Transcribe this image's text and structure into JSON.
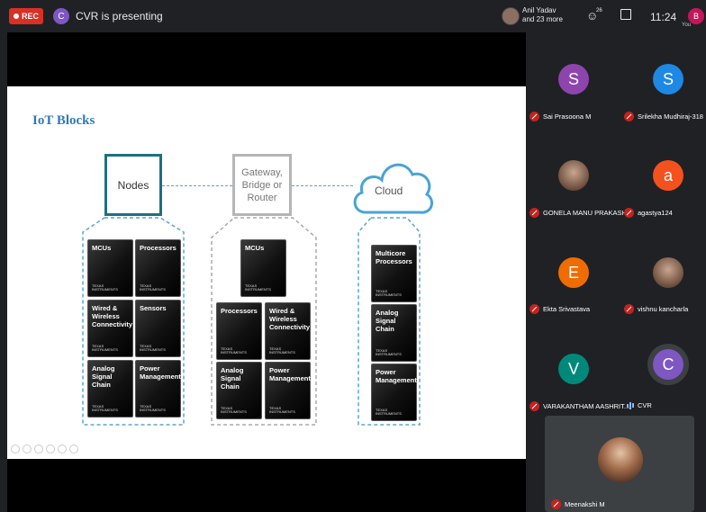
{
  "top_bar": {
    "rec_label": "REC",
    "presenter_initial": "C",
    "presenting_text": "CVR is presenting",
    "participants_stack_line1": "Anil Yadav",
    "participants_stack_line2": "and 23 more",
    "people_icon": "people-icon",
    "people_count": "26",
    "chat_icon": "chat-icon",
    "time": "11:24",
    "self_initial": "B",
    "self_label": "You"
  },
  "slide": {
    "title": "IoT Blocks",
    "nodes_label": "Nodes",
    "gateway_label": "Gateway,\nBridge or\nRouter",
    "cloud_label": "Cloud",
    "ti_line1": "TEXAS",
    "ti_line2": "INSTRUMENTS",
    "nodes_chips": [
      "MCUs",
      "Processors",
      "Wired & Wireless Connectivity",
      "Sensors",
      "Analog Signal Chain",
      "Power Management"
    ],
    "gateway_chips": [
      "MCUs",
      "Processors",
      "Wired & Wireless Connectivity",
      "Analog Signal Chain",
      "Power Management"
    ],
    "cloud_chips": [
      "Multicore Processors",
      "Analog Signal Chain",
      "Power Management"
    ]
  },
  "participants": [
    {
      "initial": "S",
      "name": "Sai Prasoona M",
      "color": "#8e44ad"
    },
    {
      "initial": "S",
      "name": "Srilekha Mudhiraj-318",
      "color": "#1e88e5"
    },
    {
      "initial": "",
      "name": "GONELA MANU PRAKASH",
      "color": "#9e9e9e"
    },
    {
      "initial": "a",
      "name": "agastya124",
      "color": "#f4511e"
    },
    {
      "initial": "E",
      "name": "Ekta Srivastava",
      "color": "#ef6c00"
    },
    {
      "initial": "",
      "name": "vishnu kancharla",
      "color": "#795548"
    },
    {
      "initial": "V",
      "name": "VARAKANTHAM AASHRIT...",
      "color": "#00897b"
    },
    {
      "initial": "C",
      "name": "CVR",
      "color": "#7e57c2"
    }
  ],
  "featured": {
    "name": "Meenakshi M"
  }
}
